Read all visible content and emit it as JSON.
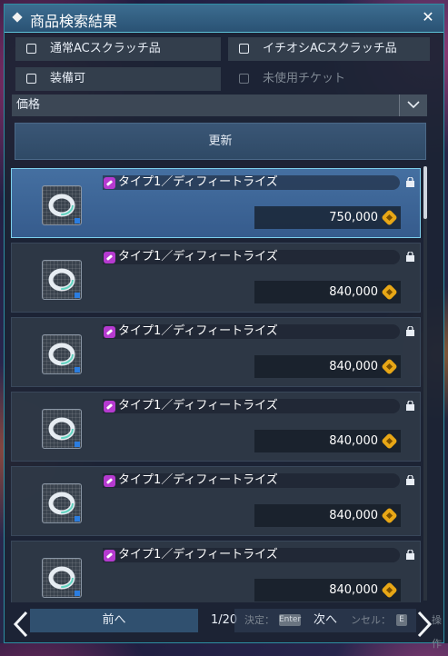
{
  "window": {
    "title": "商品検索結果"
  },
  "filters": [
    {
      "label": "通常ACスクラッチ品",
      "checked": false,
      "enabled": true
    },
    {
      "label": "イチオシACスクラッチ品",
      "checked": false,
      "enabled": true
    },
    {
      "label": "装備可",
      "checked": false,
      "enabled": true
    },
    {
      "label": "未使用チケット",
      "checked": false,
      "enabled": false
    }
  ],
  "sort": {
    "selected": "価格"
  },
  "refresh_label": "更新",
  "items": [
    {
      "name": "タイプ1／ディフィートライズ",
      "price": "750,000",
      "selected": true
    },
    {
      "name": "タイプ1／ディフィートライズ",
      "price": "840,000",
      "selected": false
    },
    {
      "name": "タイプ1／ディフィートライズ",
      "price": "840,000",
      "selected": false
    },
    {
      "name": "タイプ1／ディフィートライズ",
      "price": "840,000",
      "selected": false
    },
    {
      "name": "タイプ1／ディフィートライズ",
      "price": "840,000",
      "selected": false
    },
    {
      "name": "タイプ1／ディフィートライズ",
      "price": "840,000",
      "selected": false
    }
  ],
  "footer": {
    "prev_label": "前へ",
    "page_indicator": "1/20",
    "next_label": "次へ",
    "hint_decide": "決定：",
    "hint_decide_key": "Enter",
    "hint_cancel": "ンセル：",
    "hint_cancel_key": "E",
    "hint_operate": "操作"
  },
  "colors": {
    "accent": "#5ec4da",
    "selected_row": "#4876aa",
    "coin": "#e8a716",
    "item_icon": "#b63ad0"
  },
  "icons": [
    "close-icon",
    "chevron-down-icon",
    "weapon-type-icon",
    "lock-icon",
    "meseta-coin-icon",
    "ring-item-icon",
    "arrow-left-icon",
    "arrow-right-icon"
  ]
}
